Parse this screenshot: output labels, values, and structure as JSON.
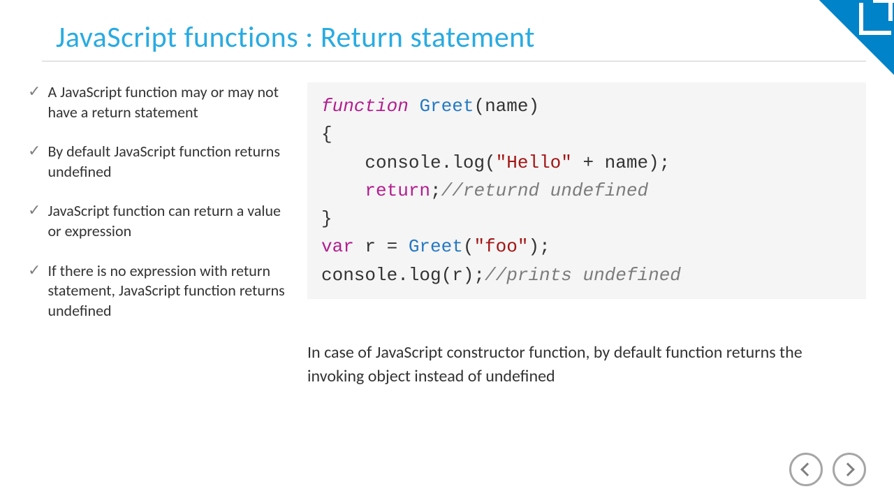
{
  "title": "JavaScript functions : Return statement",
  "bullets": [
    "A JavaScript function may or may not have a return statement",
    "By default JavaScript function returns undefined",
    "JavaScript function can return a value or expression",
    "If there  is no expression with return statement, JavaScript function returns undefined"
  ],
  "code": {
    "l1_kw": "function",
    "l1_name": "Greet",
    "l1_param": "name",
    "l2": "{",
    "l3_a": "console.log(",
    "l3_str": "\"Hello\"",
    "l3_b": " + name);",
    "l4_ret": "return",
    "l4_semi": ";",
    "l4_comment": "//returnd undefined",
    "l5": "}",
    "l6_kw": "var",
    "l6_a": " r = ",
    "l6_name": "Greet",
    "l6_b": "(",
    "l6_str": "\"foo\"",
    "l6_c": ");",
    "l7_a": "console.log(r);",
    "l7_comment": "//prints undefined"
  },
  "note": "In case of JavaScript constructor function, by default function returns the invoking object instead of undefined"
}
